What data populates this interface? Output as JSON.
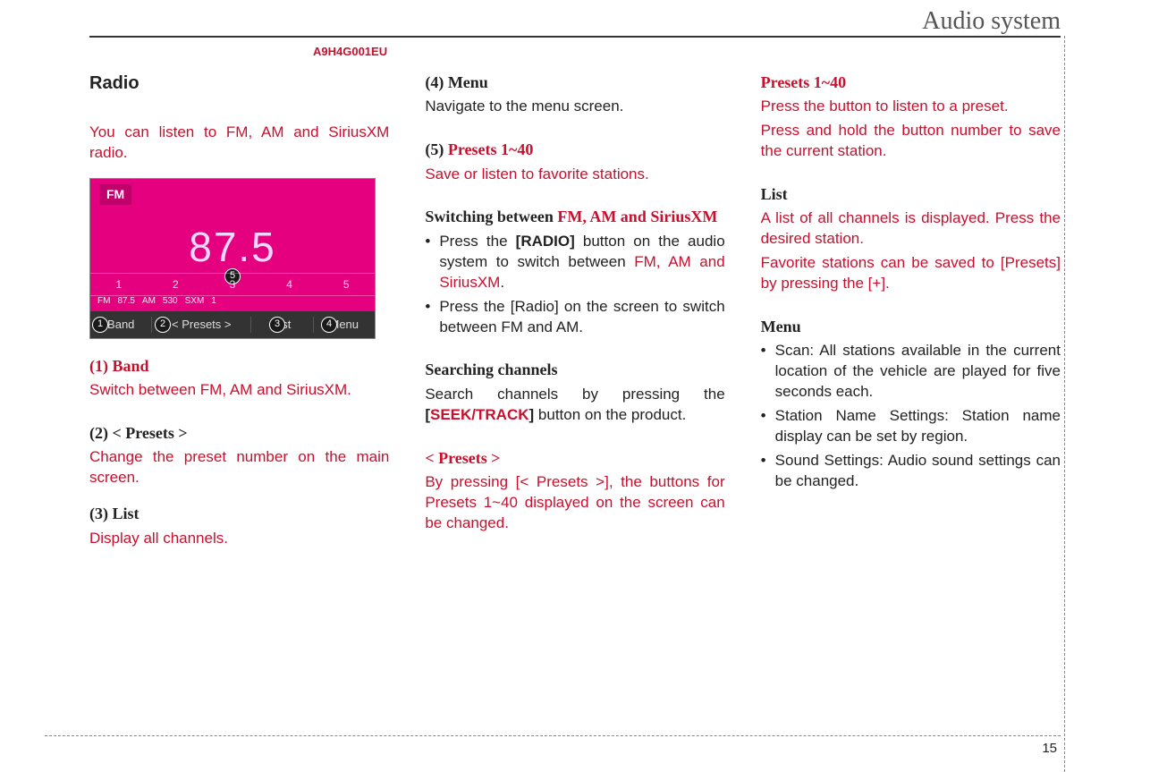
{
  "header": {
    "title": "Audio system",
    "doc_code": "A9H4G001EU"
  },
  "page_number": "15",
  "col1": {
    "title": "Radio",
    "intro_a": "You can listen to FM, AM and SiriusXM radio.",
    "screen": {
      "band": "FM",
      "freq": "87.5",
      "preset_labels": [
        "1",
        "2",
        "3",
        "4",
        "5"
      ],
      "band_row": [
        "FM",
        "87.5",
        "AM",
        "530",
        "SXM",
        "1"
      ],
      "bottom": {
        "band": "Band",
        "presets": "<  Presets  >",
        "list": "List",
        "menu": "Menu"
      }
    },
    "h1": "(1) Band",
    "p1": "Switch between FM, AM and SiriusXM.",
    "h2": "(2) < Presets >",
    "p2": "Change the preset number on the main screen.",
    "h3": "(3) List",
    "p3": "Display all channels."
  },
  "col2": {
    "h4": "(4) Menu",
    "p4": "Navigate to the menu screen.",
    "h5a": "(5)  ",
    "h5b": "Presets 1~40",
    "p5": "Save or listen to favorite stations.",
    "sw_a": "Switching between ",
    "sw_b": "FM, AM and SiriusXM",
    "sw_b1a": "Press the ",
    "sw_b1b": "[RADIO]",
    "sw_b1c": " button on the audio system to switch between ",
    "sw_b1d": "FM, AM and SiriusXM",
    "sw_b1e": ".",
    "sw_b2": "Press the [Radio] on the screen to switch between FM and AM.",
    "sc_h": "Searching channels",
    "sc_p_a": "Search channels by pressing the ",
    "sc_p_b": "[",
    "sc_p_c": "SEEK/TRACK",
    "sc_p_d": "]",
    "sc_p_e": " button on the product.",
    "pr_h": "< Presets >",
    "pr_p": "By pressing [< Presets >], the buttons for Presets 1~40 displayed on the screen can be changed."
  },
  "col3": {
    "h_presets": "Presets 1~40",
    "p_presets1": "Press the button to listen to a preset.",
    "p_presets2": "Press and hold the button number to save the current station.",
    "h_list": "List",
    "p_list1": "A list of all channels is displayed. Press the desired station.",
    "p_list2": "Favorite stations can be saved to [Presets] by pressing the [+].",
    "h_menu": "Menu",
    "menu_items": [
      "Scan: All stations available in the current location of the vehicle are played for five seconds each.",
      "Station Name Settings: Station name display can be set by region.",
      "Sound Settings: Audio sound settings can be changed."
    ]
  }
}
